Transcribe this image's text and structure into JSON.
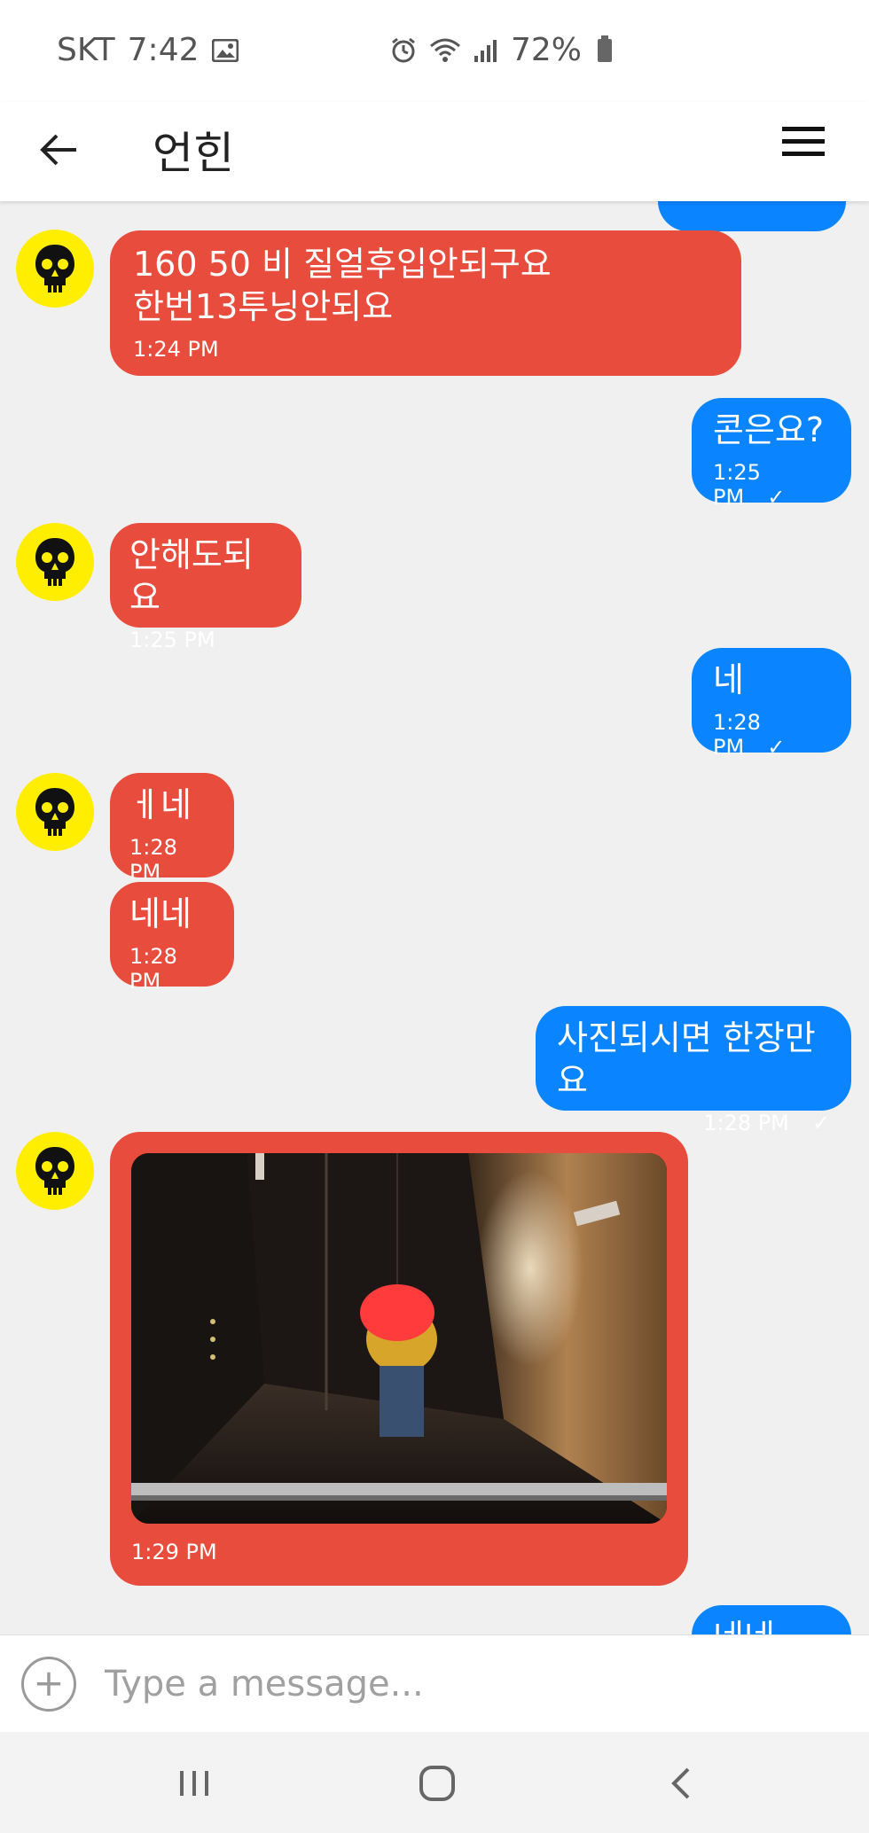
{
  "status_bar": {
    "carrier": "SKT",
    "time": "7:42",
    "battery": "72%"
  },
  "header": {
    "title": "언힌"
  },
  "messages": [
    {
      "dir": "out",
      "text": "",
      "time": ""
    },
    {
      "dir": "in",
      "text": "160 50 비 질얼후입안되구요\n한번13투닝안되요",
      "time": "1:24 PM"
    },
    {
      "dir": "out",
      "text": "콘은요?",
      "time": "1:25 PM",
      "tick": "✓"
    },
    {
      "dir": "in",
      "text": "안해도되요",
      "time": "1:25 PM"
    },
    {
      "dir": "out",
      "text": "네",
      "time": "1:28 PM",
      "tick": "✓"
    },
    {
      "dir": "in",
      "text": "ㅔ네",
      "time": "1:28 PM"
    },
    {
      "dir": "in",
      "text": "네네",
      "time": "1:28 PM"
    },
    {
      "dir": "out",
      "text": "사진되시면 한장만요",
      "time": "1:28 PM",
      "tick": "✓"
    },
    {
      "dir": "in",
      "type": "image",
      "time": "1:29 PM"
    },
    {
      "dir": "out",
      "text": "네네",
      "time": ""
    }
  ],
  "input": {
    "placeholder": "Type a message..."
  },
  "colors": {
    "incoming": "#e74c3c",
    "outgoing": "#0a84ff",
    "avatar": "#ffee00"
  },
  "icons": [
    "image-icon",
    "alarm-icon",
    "wifi-icon",
    "signal-icon",
    "battery-icon",
    "back-arrow-icon",
    "hamburger-menu-icon",
    "skull-icon",
    "add-icon",
    "recents-icon",
    "home-icon",
    "nav-back-icon"
  ]
}
